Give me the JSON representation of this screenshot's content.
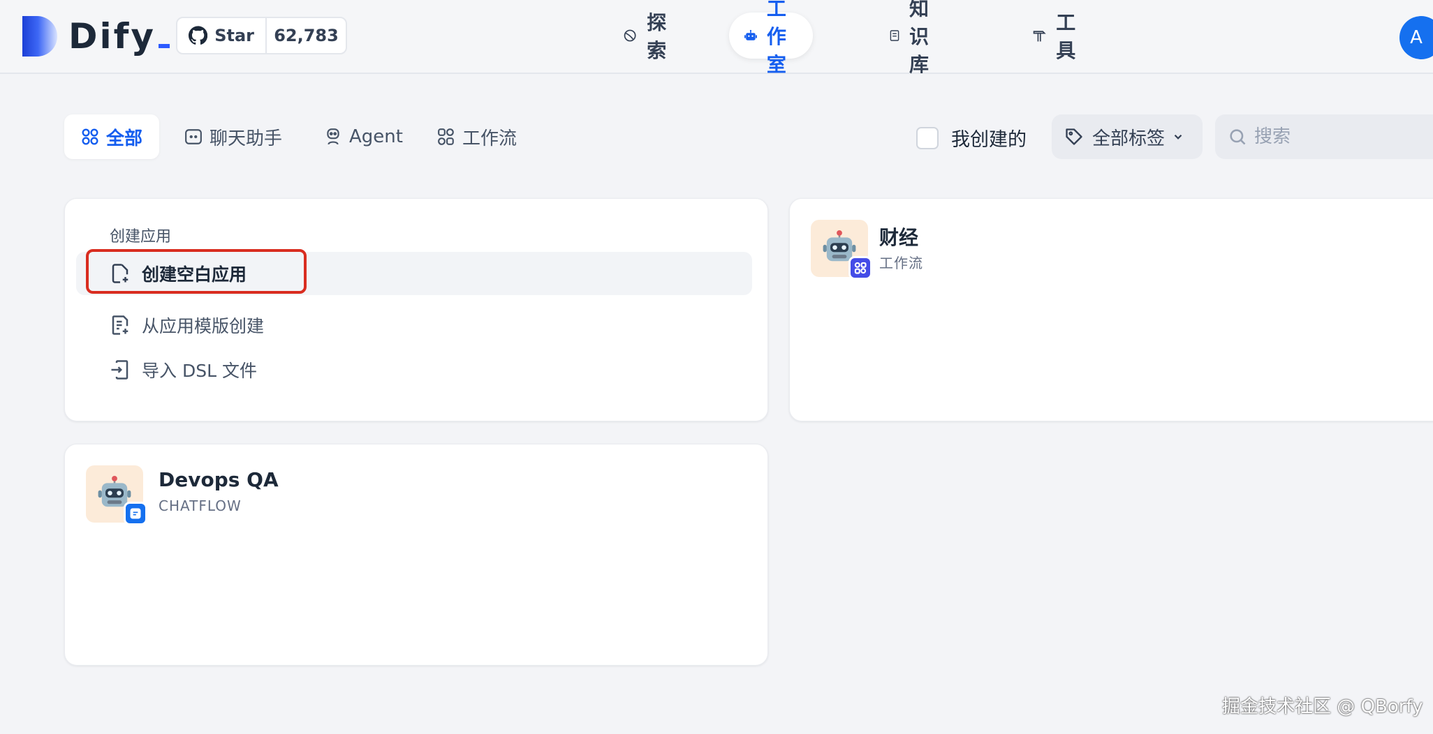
{
  "header": {
    "logo_text": "Dify",
    "github": {
      "star_label": "Star",
      "star_count": "62,783"
    },
    "nav": [
      {
        "label": "探索",
        "icon": "compass-icon"
      },
      {
        "label": "工作室",
        "icon": "robot-icon",
        "active": true
      },
      {
        "label": "知识库",
        "icon": "book-icon"
      },
      {
        "label": "工具",
        "icon": "hammer-icon"
      }
    ],
    "avatar_initial": "A"
  },
  "filters": {
    "tabs": [
      {
        "label": "全部",
        "icon": "grid-icon",
        "active": true
      },
      {
        "label": "聊天助手",
        "icon": "chat-icon"
      },
      {
        "label": "Agent",
        "icon": "agent-icon"
      },
      {
        "label": "工作流",
        "icon": "workflow-icon"
      }
    ],
    "my_created_label": "我创建的",
    "tag_select_label": "全部标签",
    "search_placeholder": "搜索"
  },
  "create_card": {
    "title": "创建应用",
    "items": [
      {
        "label": "创建空白应用",
        "icon": "new-file-icon"
      },
      {
        "label": "从应用模版创建",
        "icon": "template-icon"
      },
      {
        "label": "导入 DSL 文件",
        "icon": "import-icon"
      }
    ]
  },
  "apps": [
    {
      "name": "财经",
      "type": "工作流",
      "icon": "robot-emoji",
      "badge": "workflow-icon",
      "badge_color": "#444ce7"
    },
    {
      "name": "Devops QA",
      "type": "CHATFLOW",
      "icon": "robot-emoji",
      "badge": "chat-icon",
      "badge_color": "#1570ef"
    }
  ],
  "watermark": "掘金技术社区 @ QBorfy",
  "colors": {
    "accent": "#155eef",
    "highlight_border": "#d92d20"
  }
}
